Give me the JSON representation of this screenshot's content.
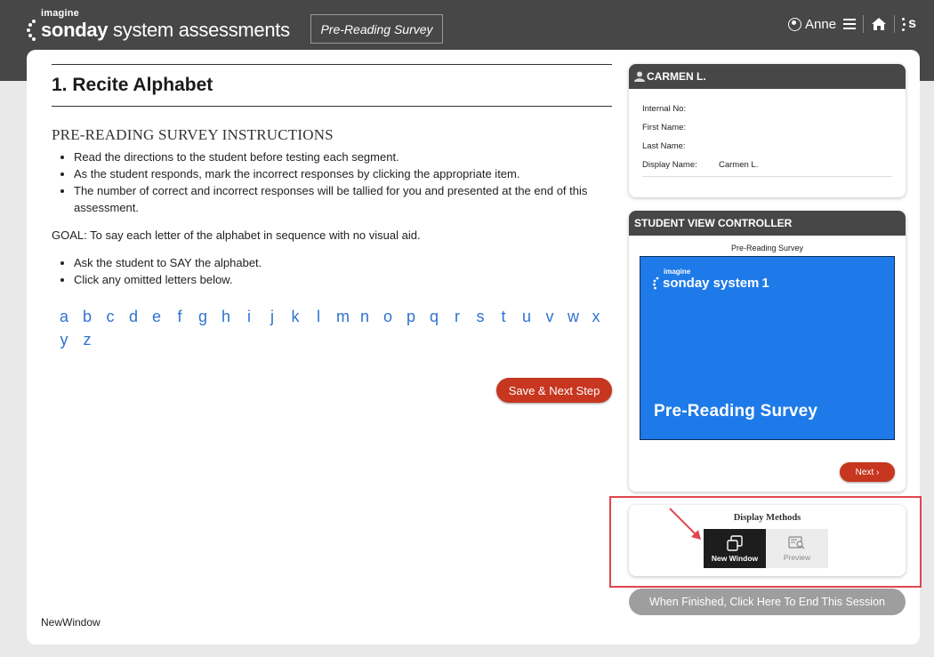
{
  "header": {
    "brand_small": "imagine",
    "brand_main": "sonday",
    "brand_rest": " system assessments",
    "survey_tab": "Pre-Reading Survey",
    "user_name": "Anne",
    "logo_letter": "s"
  },
  "main": {
    "section_title": "1. Recite Alphabet",
    "instructions_title": "PRE-READING SURVEY INSTRUCTIONS",
    "instructions": [
      "Read the directions to the student before testing each segment.",
      "As the student responds, mark the incorrect responses by clicking the appropriate item.",
      "The number of correct and incorrect responses will be tallied for you and presented at the end of this assessment."
    ],
    "goal": "GOAL: To say each letter of the alphabet in sequence with no visual aid.",
    "steps": [
      "Ask the student to SAY the alphabet.",
      "Click any omitted letters below."
    ],
    "letters": [
      "a",
      "b",
      "c",
      "d",
      "e",
      "f",
      "g",
      "h",
      "i",
      "j",
      "k",
      "l",
      "m",
      "n",
      "o",
      "p",
      "q",
      "r",
      "s",
      "t",
      "u",
      "v",
      "w",
      "x",
      "y",
      "z"
    ],
    "save_label": "Save & Next Step",
    "footer_note": "NewWindow"
  },
  "student": {
    "name": "CARMEN L.",
    "fields": [
      {
        "label": "Internal No:",
        "value": ""
      },
      {
        "label": "First Name:",
        "value": ""
      },
      {
        "label": "Last Name:",
        "value": ""
      },
      {
        "label": "Display Name:",
        "value": "Carmen L."
      }
    ]
  },
  "controller": {
    "title": "STUDENT VIEW CONTROLLER",
    "subtitle": "Pre-Reading Survey",
    "preview_brand_small": "imagine",
    "preview_brand": "sonday system",
    "preview_brand_num": "1",
    "preview_title": "Pre-Reading Survey",
    "next_label": "Next"
  },
  "display_methods": {
    "title": "Display Methods",
    "new_window_label": "New Window",
    "preview_label": "Preview"
  },
  "end_session_label": "When Finished, Click Here To End This Session",
  "colors": {
    "header_bg": "#474747",
    "accent_red": "#c7361f",
    "letter_blue": "#2f73d1",
    "preview_blue": "#1e7ae8",
    "highlight_red": "#e0454f"
  }
}
